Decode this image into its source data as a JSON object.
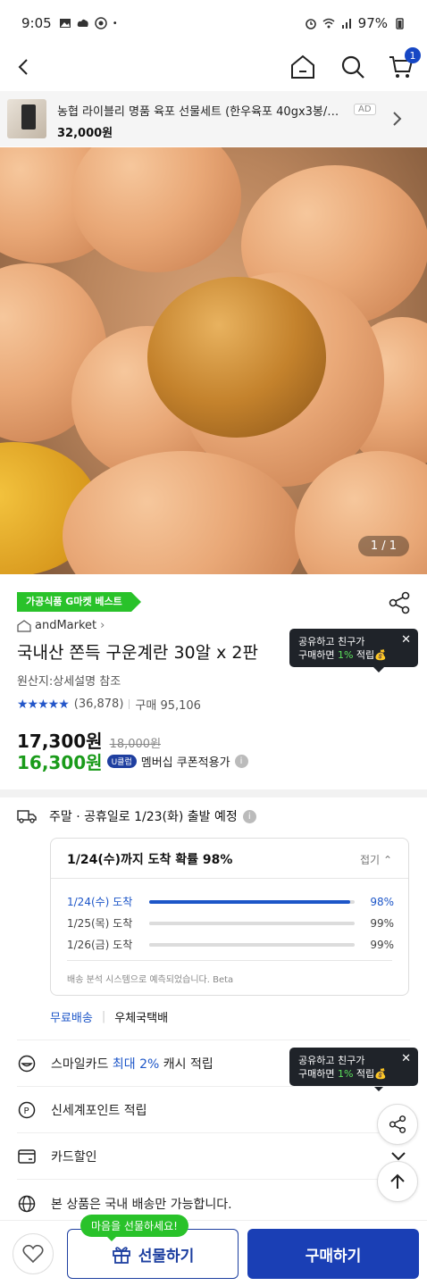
{
  "status_bar": {
    "time": "9:05",
    "battery": "97%"
  },
  "header": {
    "cart_count": "1"
  },
  "ad": {
    "title": "농협 라이블리 명품 육포 선물세트 (한우육포 40gx3봉/돈...",
    "price": "32,000원",
    "badge": "AD"
  },
  "hero": {
    "counter": "1 / 1"
  },
  "product": {
    "tag": "가공식품 G마켓 베스트",
    "seller": "andMarket",
    "title": "국내산 쫀득 구운계란 30알 x 2판",
    "origin": "원산지:상세설명 참조",
    "stars": "★★★★★",
    "review_count": "(36,878)",
    "purchases": "구매 95,106",
    "price": "17,300원",
    "original_price": "18,000원",
    "member_price": "16,300원",
    "member_badge": "U클럽",
    "member_text": "멤버십 쿠폰적용가"
  },
  "tooltip": {
    "line1": "공유하고 친구가",
    "line2_prefix": "구매하면 ",
    "line2_highlight": "1%",
    "line2_suffix": " 적립💰"
  },
  "shipping": {
    "schedule": "주말 · 공휴일로 1/23(화) 출발 예정",
    "arrival_title": "1/24(수)까지 도착 확률 98%",
    "fold_label": "접기",
    "rows": [
      {
        "date": "1/24(수) 도착",
        "percent": "98%",
        "value": 0.98
      },
      {
        "date": "1/25(목) 도착",
        "percent": "99%",
        "value": 0.99
      },
      {
        "date": "1/26(금) 도착",
        "percent": "99%",
        "value": 0.99
      }
    ],
    "note": "배송 분석 시스템으로 예측되었습니다. Beta",
    "free_label": "무료배송",
    "carrier": "우체국택배"
  },
  "options": {
    "smile_prefix": "스마일카드 ",
    "smile_highlight": "최대 2%",
    "smile_suffix": " 캐시 적립",
    "point": "신세계포인트 적립",
    "card": "카드할인",
    "domestic": "본 상품은 국내 배송만 가능합니다."
  },
  "bottom": {
    "gift_bubble": "마음을 선물하세요!",
    "gift_label": "선물하기",
    "buy_label": "구매하기"
  },
  "colors": {
    "accent": "#1a3fb5",
    "green": "#29c22a",
    "member_green": "#1a9b1a"
  }
}
